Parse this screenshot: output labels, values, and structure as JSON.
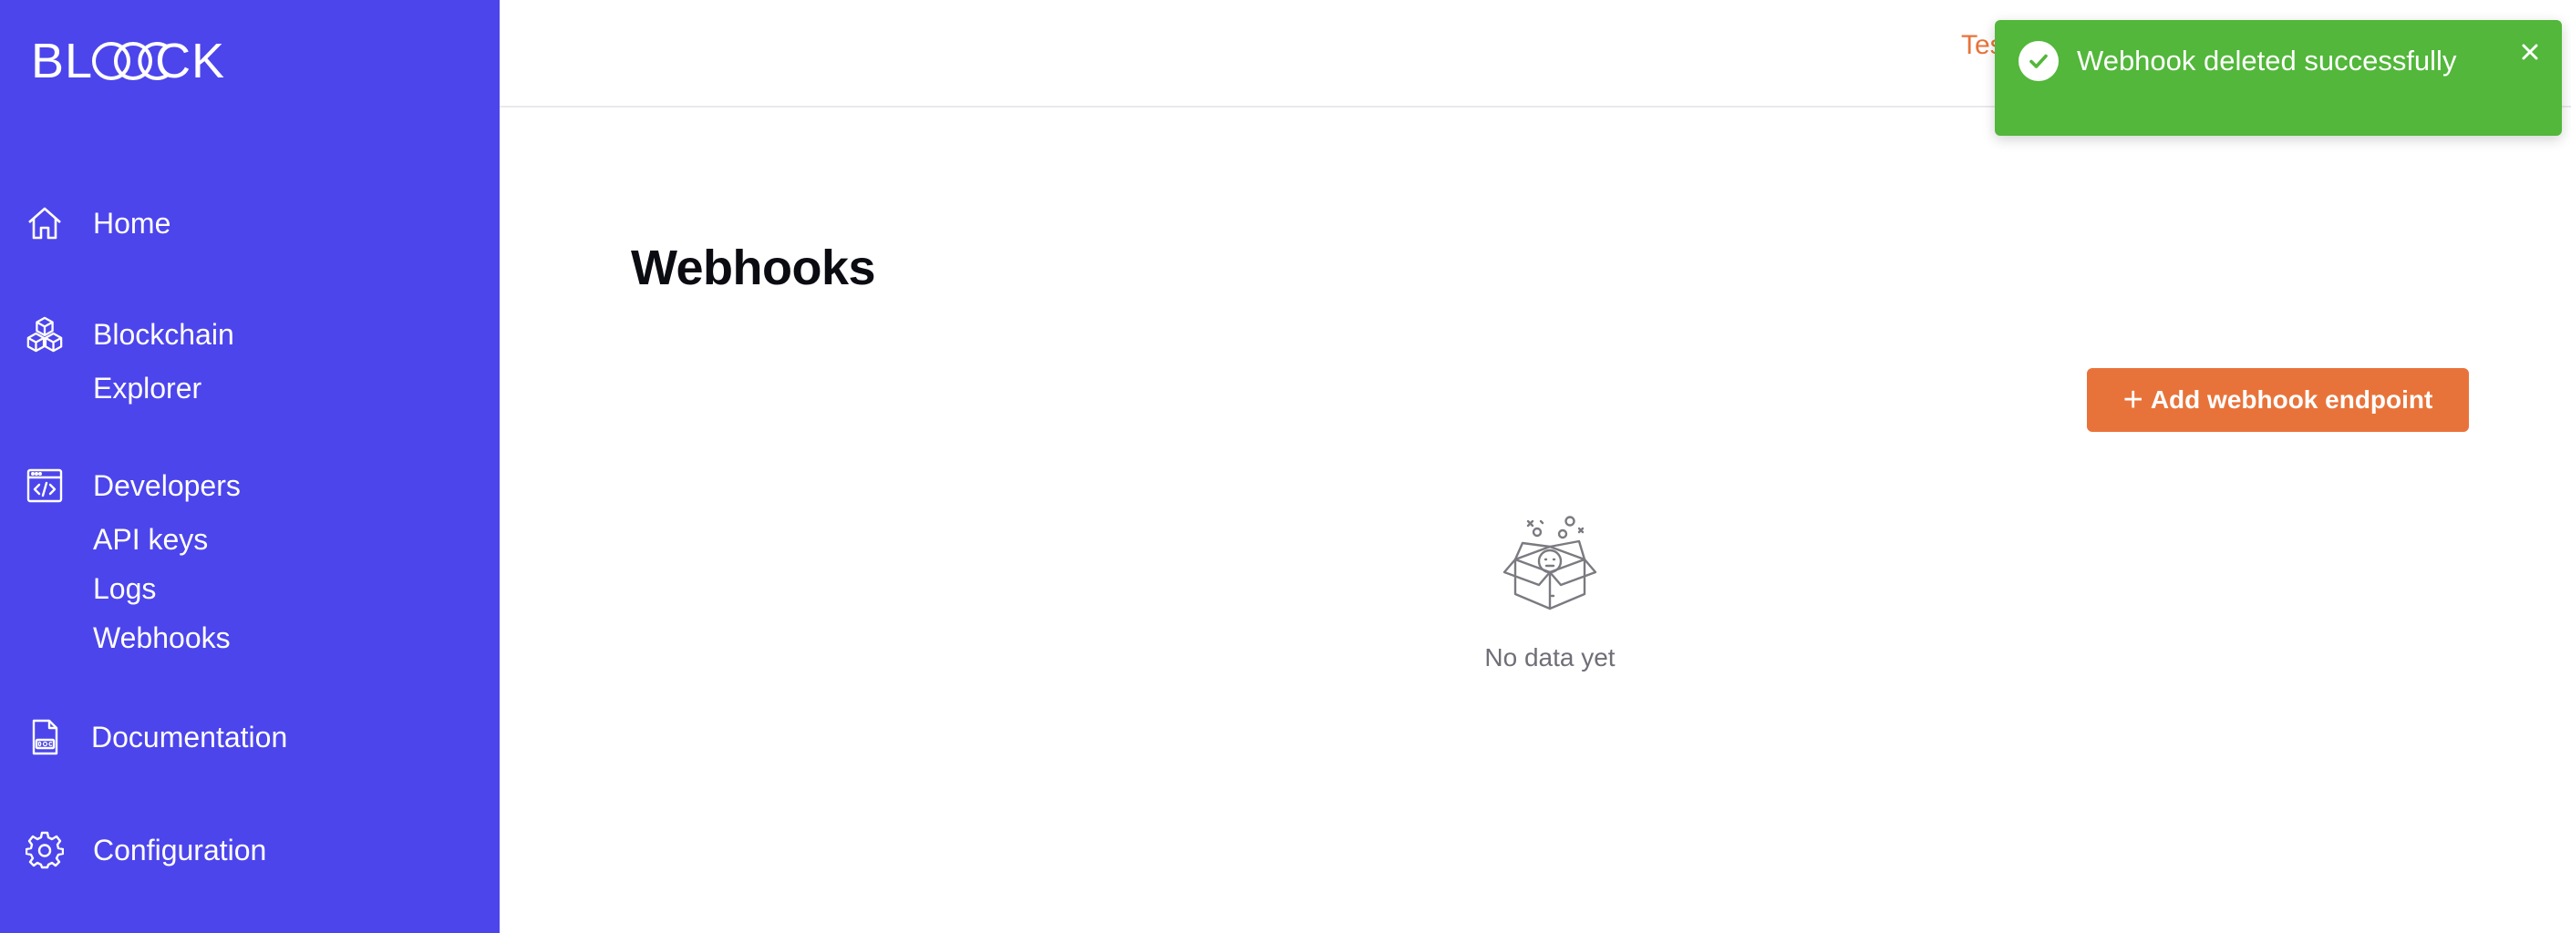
{
  "app": {
    "logo_left": "BL",
    "logo_right": "CK"
  },
  "sidebar": {
    "items": [
      {
        "label": "Home",
        "icon": "home-icon"
      },
      {
        "label": "Blockchain",
        "icon": "cubes-icon",
        "sub": [
          "Explorer"
        ]
      },
      {
        "label": "Developers",
        "icon": "code-window-icon",
        "sub": [
          "API keys",
          "Logs",
          "Webhooks"
        ]
      },
      {
        "label": "Documentation",
        "icon": "doc-file-icon"
      },
      {
        "label": "Configuration",
        "icon": "gear-icon"
      }
    ]
  },
  "topbar": {
    "env_label": "Tes"
  },
  "main": {
    "title": "Webhooks",
    "add_button": "Add webhook endpoint",
    "empty_text": "No data yet"
  },
  "toast": {
    "message": "Webhook deleted successfully",
    "icon": "check-circle-icon",
    "close_icon": "close-icon"
  },
  "colors": {
    "sidebar": "#4c45ec",
    "accent": "#e8733a",
    "toast": "#52b73a"
  }
}
